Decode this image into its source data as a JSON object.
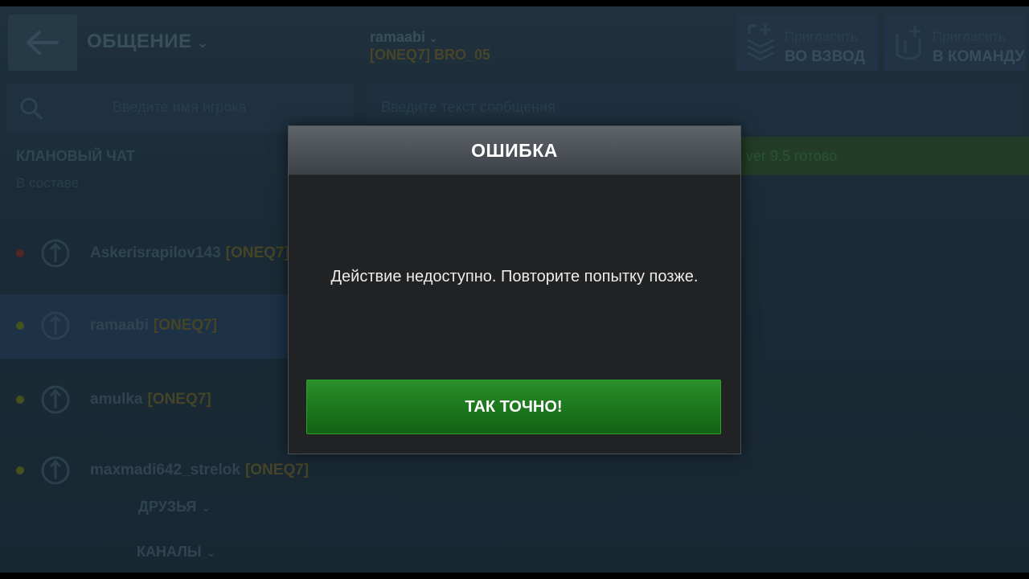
{
  "header": {
    "section_title": "ОБЩЕНИЕ",
    "user_name": "ramaabi",
    "user_clan": "[ONEQ7] BRO_05",
    "invite_platoon": {
      "line1": "Пригласить",
      "line2": "ВО ВЗВОД"
    },
    "invite_team": {
      "line1": "Пригласить",
      "line2": "В КОМАНДУ"
    }
  },
  "search": {
    "placeholder": "Введите имя игрока"
  },
  "message": {
    "placeholder": "Введите текст сообщения"
  },
  "clan_chat": {
    "title": "КЛАНОВЫЙ ЧАТ",
    "subtitle": "В составе",
    "members": [
      {
        "name": "Askerisrapilov143",
        "tag": "[ONEQ7]",
        "status_color": "#5a2a2a"
      },
      {
        "name": "ramaabi",
        "tag": "[ONEQ7]",
        "status_color": "#4d5a1f"
      },
      {
        "name": "amulka",
        "tag": "[ONEQ7]",
        "status_color": "#4d5a1f"
      },
      {
        "name": "maxmadi642_strelok",
        "tag": "[ONEQ7]",
        "status_color": "#4d5a1f"
      }
    ]
  },
  "groups": {
    "friends": "ДРУЗЬЯ",
    "channels": "КАНАЛЫ"
  },
  "banner": {
    "text": "ver 9.5 готово"
  },
  "dialog": {
    "title": "ОШИБКА",
    "message": "Действие недоступно. Повторите попытку позже.",
    "confirm_label": "ТАК ТОЧНО!"
  },
  "colors": {
    "accent_green": "#1d7a1e",
    "clan_tag": "#4b4a2a",
    "background": "#1d2f3c"
  }
}
